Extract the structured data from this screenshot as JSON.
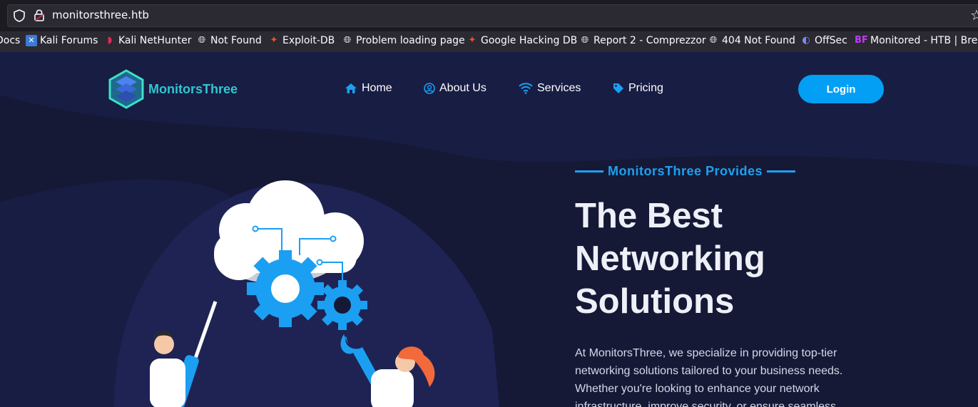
{
  "browser": {
    "url": "monitorsthree.htb",
    "bookmarks": [
      {
        "label": "Docs",
        "icon": "none"
      },
      {
        "label": "Kali Forums",
        "icon": "kali-forums-icon"
      },
      {
        "label": "Kali NetHunter",
        "icon": "kali-nethunter-icon"
      },
      {
        "label": "Not Found",
        "icon": "globe-icon"
      },
      {
        "label": "Exploit-DB",
        "icon": "exploit-db-icon"
      },
      {
        "label": "Problem loading page",
        "icon": "globe-icon"
      },
      {
        "label": "Google Hacking DB",
        "icon": "exploit-db-icon"
      },
      {
        "label": "Report 2 - Comprezzor",
        "icon": "globe-icon"
      },
      {
        "label": "404 Not Found",
        "icon": "globe-icon"
      },
      {
        "label": "OffSec",
        "icon": "offsec-icon"
      },
      {
        "label": "Monitored - HTB | Bre…",
        "icon": "bf-icon"
      }
    ]
  },
  "site": {
    "logo_text": "MonitorsThree",
    "nav": {
      "home": "Home",
      "about": "About Us",
      "services": "Services",
      "pricing": "Pricing"
    },
    "login_label": "Login",
    "hero": {
      "eyebrow": "MonitorsThree Provides",
      "headline_1": "The Best",
      "headline_2": "Networking",
      "headline_3": "Solutions",
      "paragraph": "At MonitorsThree, we specialize in providing top-tier networking solutions tailored to your business needs. Whether you're looking to enhance your network infrastructure, improve security, or ensure seamless"
    }
  },
  "colors": {
    "page_bg": "#151936",
    "accent": "#039ff5",
    "logo_text": "#32c5d2",
    "headline": "#eef0f7"
  }
}
